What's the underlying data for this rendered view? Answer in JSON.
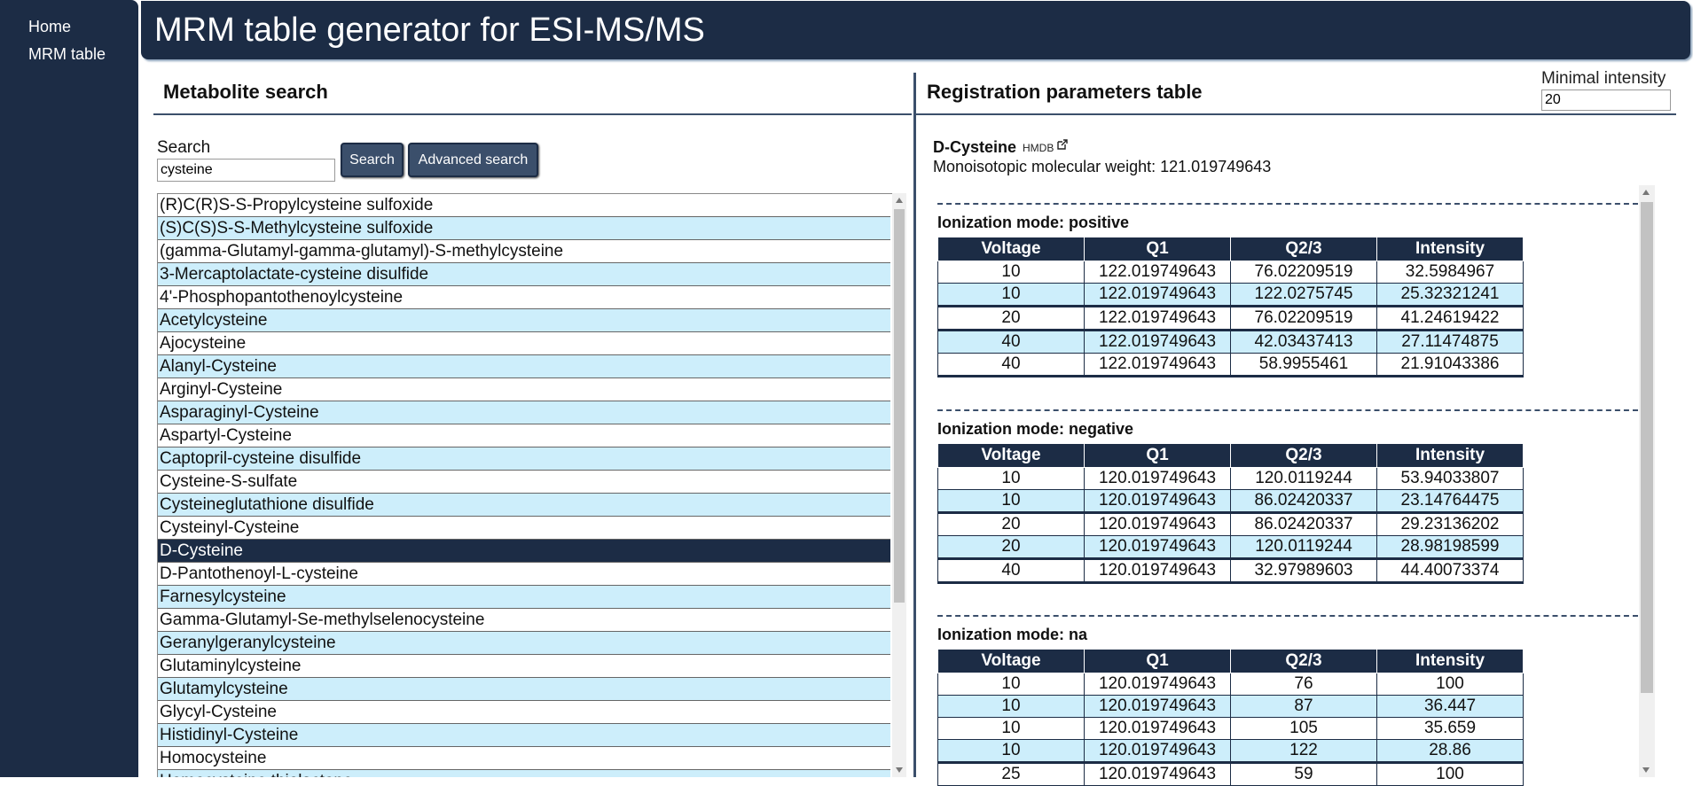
{
  "nav": {
    "home": "Home",
    "mrm_table": "MRM table"
  },
  "header": {
    "title": "MRM table generator for ESI-MS/MS"
  },
  "left_panel": {
    "title": "Metabolite search",
    "search_label": "Search",
    "search_value": "cysteine",
    "search_button": "Search",
    "advanced_button": "Advanced search",
    "results": [
      "(R)C(R)S-S-Propylcysteine sulfoxide",
      "(S)C(S)S-S-Methylcysteine sulfoxide",
      "(gamma-Glutamyl-gamma-glutamyl)-S-methylcysteine",
      "3-Mercaptolactate-cysteine disulfide",
      "4'-Phosphopantothenoylcysteine",
      "Acetylcysteine",
      "Ajocysteine",
      "Alanyl-Cysteine",
      "Arginyl-Cysteine",
      "Asparaginyl-Cysteine",
      "Aspartyl-Cysteine",
      "Captopril-cysteine disulfide",
      "Cysteine-S-sulfate",
      "Cysteineglutathione disulfide",
      "Cysteinyl-Cysteine",
      "D-Cysteine",
      "D-Pantothenoyl-L-cysteine",
      "Farnesylcysteine",
      "Gamma-Glutamyl-Se-methylselenocysteine",
      "Geranylgeranylcysteine",
      "Glutaminylcysteine",
      "Glutamylcysteine",
      "Glycyl-Cysteine",
      "Histidinyl-Cysteine",
      "Homocysteine",
      "Homocysteine thiolactone"
    ],
    "selected_index": 15
  },
  "right_panel": {
    "title": "Registration parameters table",
    "min_intensity_label": "Minimal intensity",
    "min_intensity_value": "20",
    "compound_name": "D-Cysteine",
    "hmdb_link": "HMDB",
    "monoisotopic": "Monoisotopic molecular weight: 121.019749643",
    "columns": [
      "Voltage",
      "Q1",
      "Q2/3",
      "Intensity"
    ],
    "modes": [
      {
        "title": "Ionization mode: positive",
        "rows": [
          [
            "10",
            "122.019749643",
            "76.02209519",
            "32.5984967"
          ],
          [
            "10",
            "122.019749643",
            "122.0275745",
            "25.32321241"
          ],
          [
            "20",
            "122.019749643",
            "76.02209519",
            "41.24619422"
          ],
          [
            "40",
            "122.019749643",
            "42.03437413",
            "27.11474875"
          ],
          [
            "40",
            "122.019749643",
            "58.9955461",
            "21.91043386"
          ]
        ]
      },
      {
        "title": "Ionization mode: negative",
        "rows": [
          [
            "10",
            "120.019749643",
            "120.0119244",
            "53.94033807"
          ],
          [
            "10",
            "120.019749643",
            "86.02420337",
            "23.14764475"
          ],
          [
            "20",
            "120.019749643",
            "86.02420337",
            "29.23136202"
          ],
          [
            "20",
            "120.019749643",
            "120.0119244",
            "28.98198599"
          ],
          [
            "40",
            "120.019749643",
            "32.97989603",
            "44.40073374"
          ]
        ]
      },
      {
        "title": "Ionization mode: na",
        "rows": [
          [
            "10",
            "120.019749643",
            "76",
            "100"
          ],
          [
            "10",
            "120.019749643",
            "87",
            "36.447"
          ],
          [
            "10",
            "120.019749643",
            "105",
            "35.659"
          ],
          [
            "10",
            "120.019749643",
            "122",
            "28.86"
          ],
          [
            "25",
            "120.019749643",
            "59",
            "100"
          ]
        ]
      }
    ]
  },
  "colors": {
    "navy": "#1c2c45",
    "accent": "#3b4f6b",
    "row_alt": "#cdeefb"
  }
}
